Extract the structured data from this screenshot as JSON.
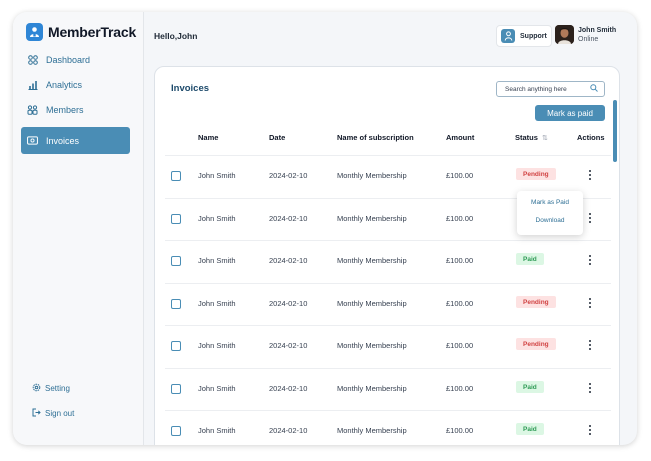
{
  "app": {
    "name": "MemberTrack"
  },
  "sidebar": {
    "items": [
      {
        "label": "Dashboard",
        "icon": "grid-icon"
      },
      {
        "label": "Analytics",
        "icon": "bar-chart-icon"
      },
      {
        "label": "Members",
        "icon": "members-icon"
      },
      {
        "label": "Invoices",
        "icon": "invoice-icon",
        "active": true
      }
    ],
    "footer": [
      {
        "label": "Setting",
        "icon": "gear-icon"
      },
      {
        "label": "Sign out",
        "icon": "sign-out-icon"
      }
    ]
  },
  "header": {
    "greeting": "Hello,John",
    "support_label": "Support",
    "user": {
      "name": "John Smith",
      "status": "Online"
    }
  },
  "invoices": {
    "title": "Invoices",
    "search_placeholder": "Search anything here",
    "mark_paid_label": "Mark as paid",
    "columns": [
      "Name",
      "Date",
      "Name of subscription",
      "Amount",
      "Status",
      "Actions"
    ],
    "rows": [
      {
        "name": "John Smith",
        "date": "2024-02-10",
        "subscription": "Monthly Membership",
        "amount": "£100.00",
        "status": "Pending"
      },
      {
        "name": "John Smith",
        "date": "2024-02-10",
        "subscription": "Monthly Membership",
        "amount": "£100.00",
        "status": ""
      },
      {
        "name": "John Smith",
        "date": "2024-02-10",
        "subscription": "Monthly Membership",
        "amount": "£100.00",
        "status": "Paid"
      },
      {
        "name": "John Smith",
        "date": "2024-02-10",
        "subscription": "Monthly Membership",
        "amount": "£100.00",
        "status": "Pending"
      },
      {
        "name": "John Smith",
        "date": "2024-02-10",
        "subscription": "Monthly Membership",
        "amount": "£100.00",
        "status": "Pending"
      },
      {
        "name": "John Smith",
        "date": "2024-02-10",
        "subscription": "Monthly Membership",
        "amount": "£100.00",
        "status": "Paid"
      },
      {
        "name": "John Smith",
        "date": "2024-02-10",
        "subscription": "Monthly Membership",
        "amount": "£100.00",
        "status": "Paid"
      }
    ],
    "row_menu": {
      "items": [
        "Mark as Paid",
        "Download"
      ]
    }
  },
  "colors": {
    "accent": "#4a8db5",
    "brand": "#2f86d6",
    "pending": "#d14343",
    "paid": "#2e9b55"
  }
}
